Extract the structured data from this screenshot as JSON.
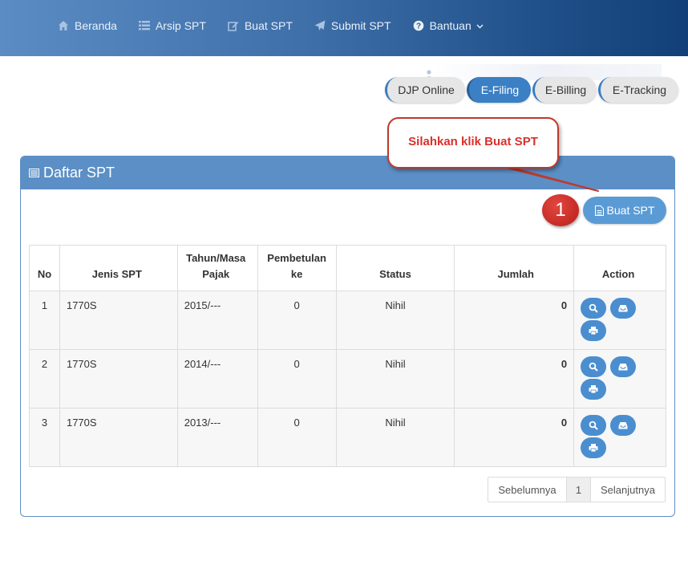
{
  "nav": {
    "items": [
      {
        "label": "Beranda",
        "icon": "home-icon"
      },
      {
        "label": "Arsip SPT",
        "icon": "list-icon"
      },
      {
        "label": "Buat SPT",
        "icon": "edit-icon"
      },
      {
        "label": "Submit SPT",
        "icon": "send-icon"
      },
      {
        "label": "Bantuan",
        "icon": "question-circle-icon"
      }
    ]
  },
  "tabs": [
    "DJP Online",
    "E-Filing",
    "E-Billing",
    "E-Tracking"
  ],
  "active_tab": "E-Filing",
  "callout": {
    "text": "Silahkan klik Buat SPT",
    "step": "1"
  },
  "panel": {
    "title": "Daftar SPT",
    "create_button": "Buat SPT"
  },
  "table": {
    "headers": {
      "no": "No",
      "jenis": "Jenis SPT",
      "tahun": "Tahun/Masa Pajak",
      "pembetulan": "Pembetulan ke",
      "status": "Status",
      "jumlah": "Jumlah",
      "action": "Action"
    },
    "rows": [
      {
        "no": "1",
        "jenis": "1770S",
        "tahun": "2015/---",
        "pembetulan": "0",
        "status": "Nihil",
        "jumlah": "0"
      },
      {
        "no": "2",
        "jenis": "1770S",
        "tahun": "2014/---",
        "pembetulan": "0",
        "status": "Nihil",
        "jumlah": "0"
      },
      {
        "no": "3",
        "jenis": "1770S",
        "tahun": "2013/---",
        "pembetulan": "0",
        "status": "Nihil",
        "jumlah": "0"
      }
    ]
  },
  "pagination": {
    "prev": "Sebelumnya",
    "current": "1",
    "next": "Selanjutnya"
  },
  "colors": {
    "header_blue": "#5b8fc6",
    "button_blue": "#5b9bd5",
    "callout_red": "#d9312b"
  }
}
